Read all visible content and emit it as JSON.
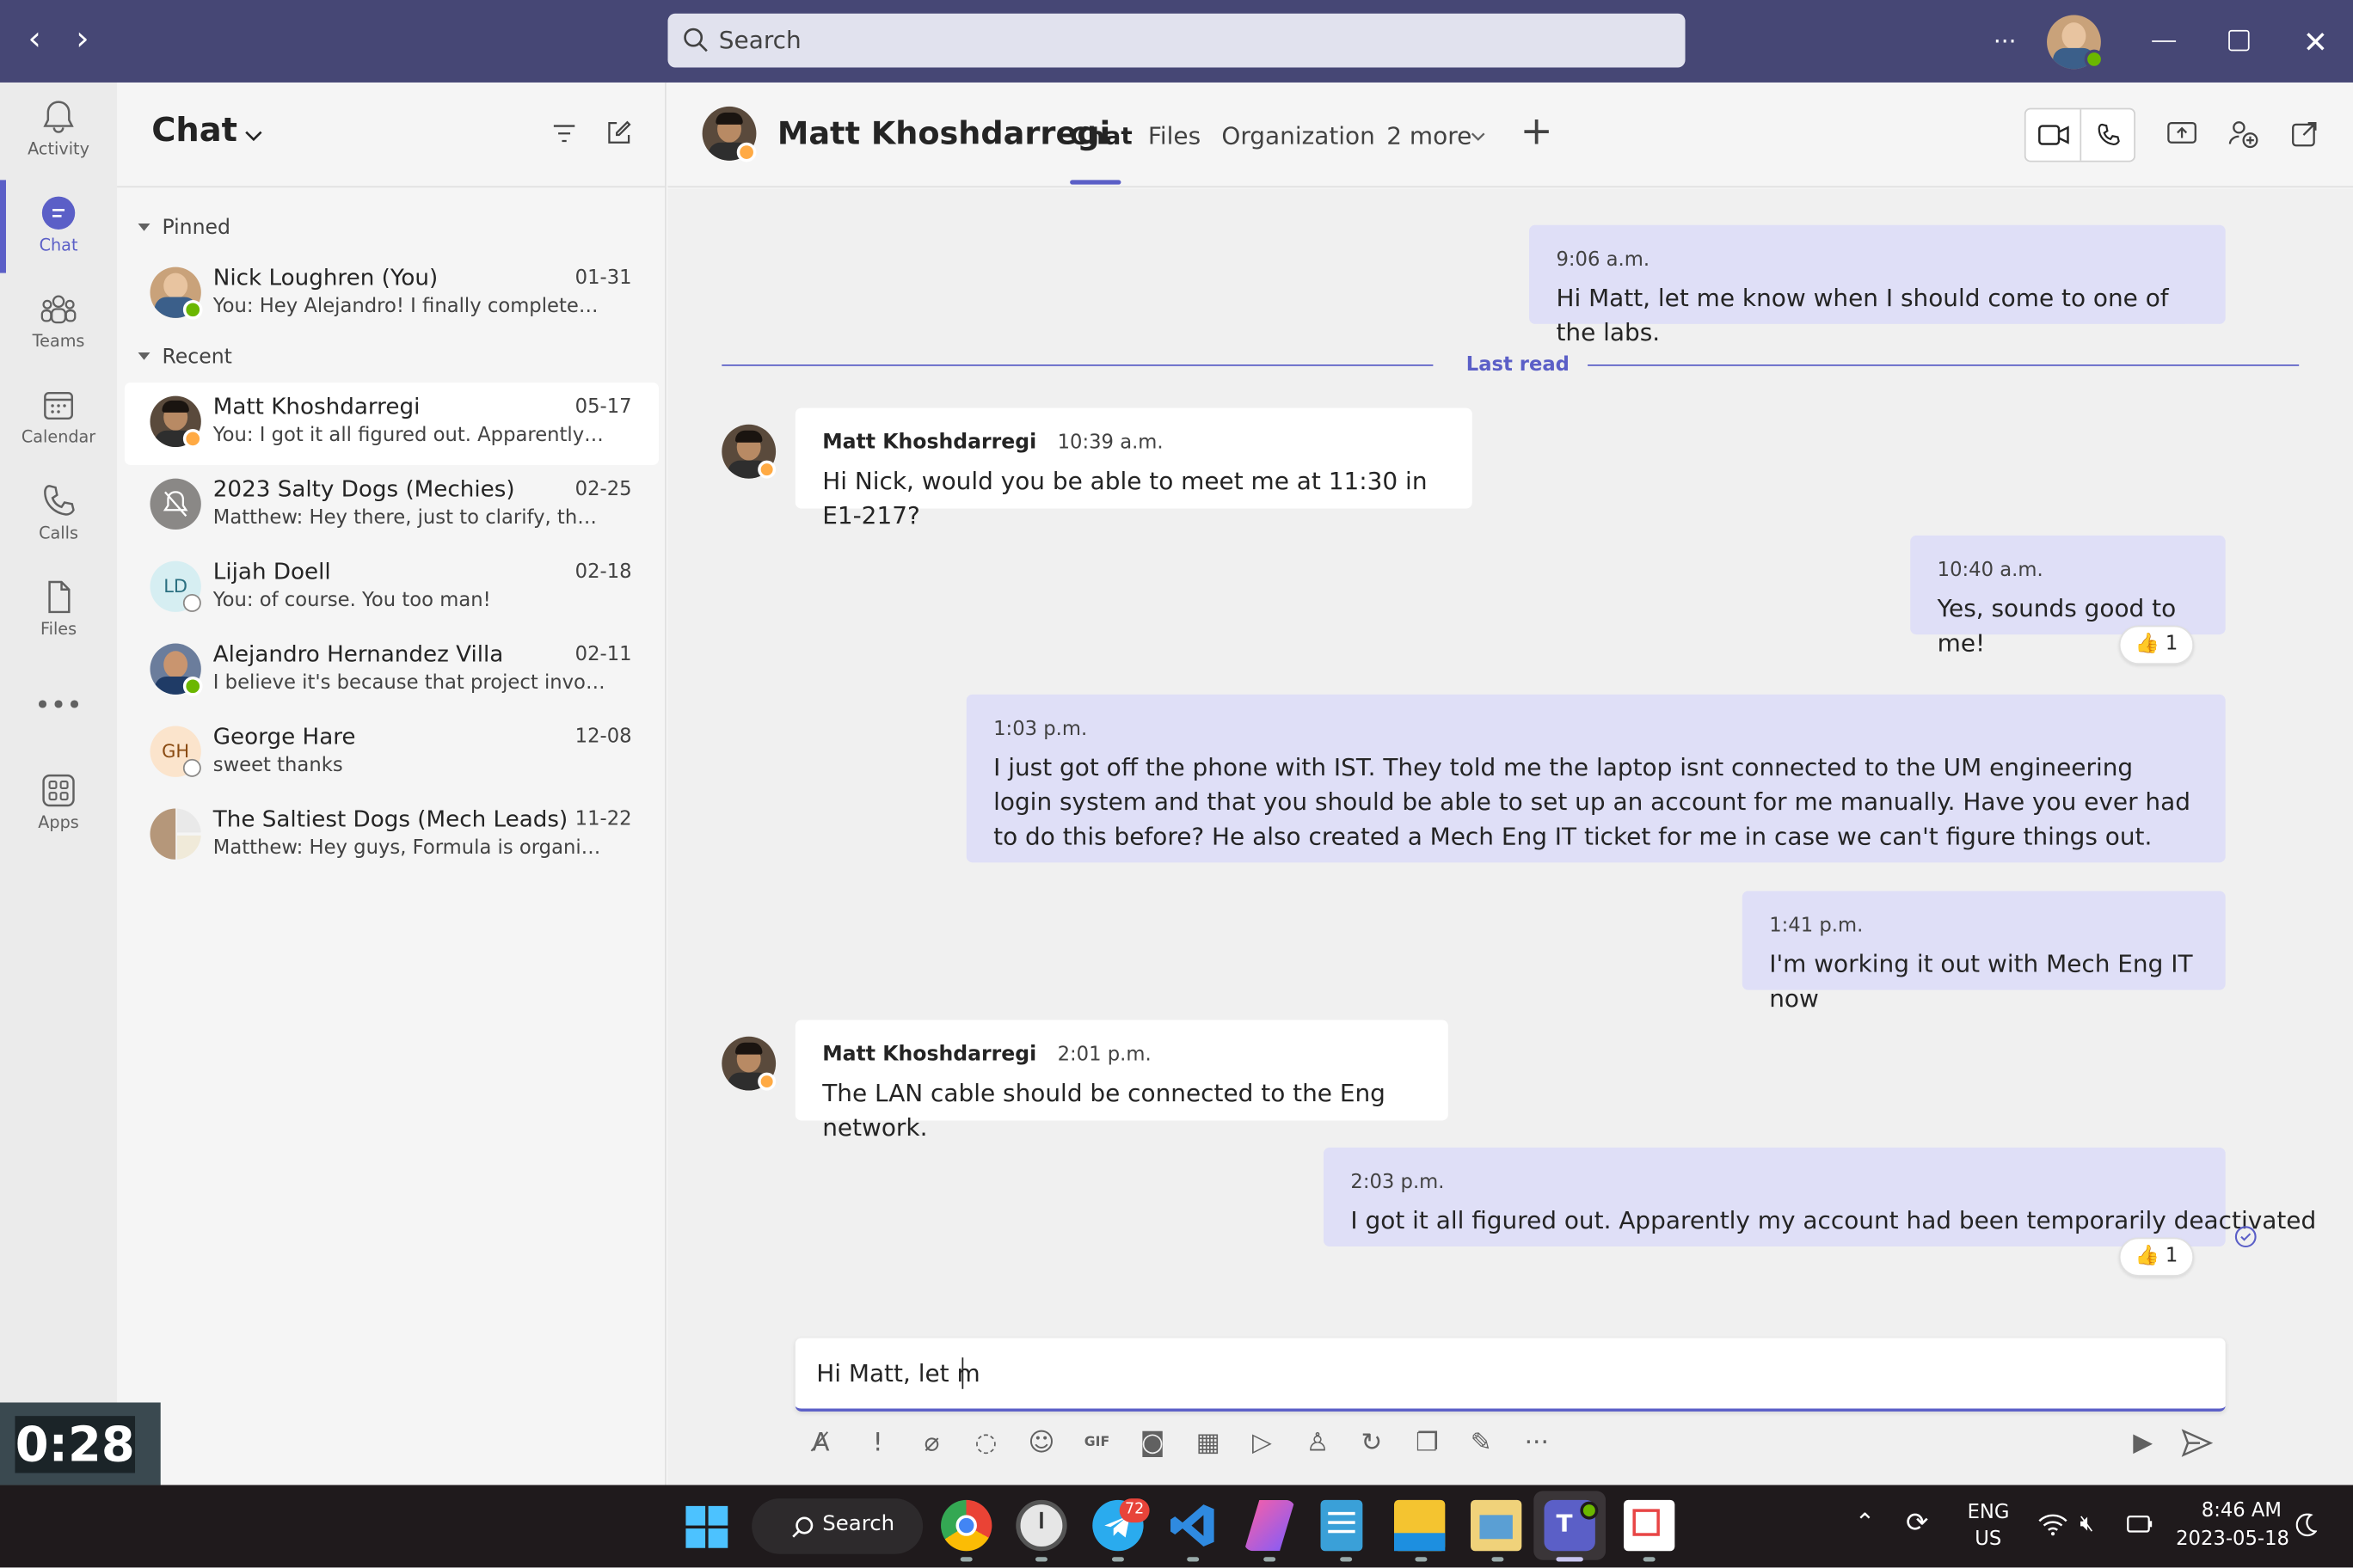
{
  "titlebar": {
    "search_placeholder": "Search",
    "more": "···"
  },
  "rail": [
    {
      "label": "Activity",
      "icon": "bell-icon"
    },
    {
      "label": "Chat",
      "icon": "chat-icon",
      "active": true
    },
    {
      "label": "Teams",
      "icon": "teams-icon"
    },
    {
      "label": "Calendar",
      "icon": "calendar-icon"
    },
    {
      "label": "Calls",
      "icon": "phone-icon"
    },
    {
      "label": "Files",
      "icon": "file-icon"
    },
    {
      "label": "Apps",
      "icon": "apps-icon"
    }
  ],
  "chatlist": {
    "title": "Chat",
    "pinned_label": "Pinned",
    "recent_label": "Recent",
    "pinned": [
      {
        "name": "Nick Loughren (You)",
        "date": "01-31",
        "preview": "You: Hey Alejandro! I finally completed the...",
        "status": "available"
      }
    ],
    "recent": [
      {
        "name": "Matt Khoshdarregi",
        "date": "05-17",
        "preview": "You: I got it all figured out. Apparently my account...",
        "status": "away",
        "selected": true
      },
      {
        "name": "2023 Salty Dogs (Mechies)",
        "date": "02-25",
        "preview": "Matthew: Hey there, just to clarify, there's...",
        "status": "muted"
      },
      {
        "name": "Lijah Doell",
        "date": "02-18",
        "preview": "You: of course. You too man!",
        "initials": "LD",
        "status": "offline"
      },
      {
        "name": "Alejandro Hernandez Villa",
        "date": "02-11",
        "preview": "I believe it's because that project involves...",
        "status": "available"
      },
      {
        "name": "George Hare",
        "date": "12-08",
        "preview": "sweet thanks",
        "initials": "GH",
        "status": "offline"
      },
      {
        "name": "The Saltiest Dogs (Mech Leads)",
        "date": "11-22",
        "preview": "Matthew: Hey guys, Formula is organizing...",
        "status": "group"
      }
    ]
  },
  "main": {
    "contact_name": "Matt Khoshdarregi",
    "tabs": [
      "Chat",
      "Files",
      "Organization",
      "2 more"
    ],
    "last_read": "Last read",
    "messages": [
      {
        "time": "9:06 a.m.",
        "text": "Hi Matt, let me know when I should come to one of the labs.",
        "from": "me"
      },
      {
        "sender": "Matt Khoshdarregi",
        "time": "10:39 a.m.",
        "text": "Hi Nick, would you be able to meet me at 11:30 in E1-217?",
        "from": "them"
      },
      {
        "time": "10:40 a.m.",
        "text": "Yes, sounds good to me!",
        "from": "me",
        "reaction": "1"
      },
      {
        "time": "1:03 p.m.",
        "text": "I just got off the phone with IST. They told me the laptop isnt connected to the UM engineering login system and that you should be able to set up an account for me manually. Have you ever had to do this before? He also created a Mech Eng IT ticket for me in case we can't figure things out.",
        "from": "me"
      },
      {
        "time": "1:41 p.m.",
        "text": "I'm working it out with Mech Eng IT now",
        "from": "me"
      },
      {
        "sender": "Matt Khoshdarregi",
        "time": "2:01 p.m.",
        "text": "The LAN cable should be connected to the Eng network.",
        "from": "them"
      },
      {
        "time": "2:03 p.m.",
        "text": "I got it all figured out. Apparently my account had been temporarily deactivated",
        "from": "me",
        "reaction": "1"
      }
    ],
    "composer_value": "Hi Matt, let m"
  },
  "timer": "0:28",
  "taskbar": {
    "search_label": "Search",
    "telegram_badge": "72",
    "lang_top": "ENG",
    "lang_bottom": "US",
    "time": "8:46 AM",
    "date": "2023-05-18"
  },
  "colors": {
    "titlebar": "#464775",
    "accent": "#5b5fc7",
    "my_bubble": "#dfdff7",
    "available": "#6bb700",
    "away": "#ffaa44"
  }
}
